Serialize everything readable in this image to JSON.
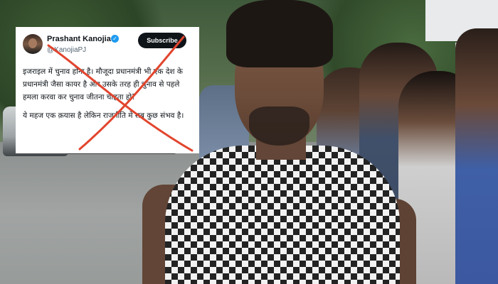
{
  "tweet": {
    "display_name": "Prashant Kanojia",
    "handle": "@KanojiaPJ",
    "subscribe_label": "Subscribe",
    "paragraph_1": "इजराइल में चुनाव होना है। मौजूदा प्रधानमंत्री भी एक देश के प्रधानमंत्री जैसा कायर है और उसके तरह ही चुनाव से पहले हमला करवा कर चुनाव जीतना चाहता हो?",
    "paragraph_2": "ये महज एक क़यास है लेकिन राजनीति में सब कुछ संभव है।"
  },
  "colors": {
    "cross_mark": "#e2452e",
    "verified_badge": "#1d9bf0",
    "subscribe_bg": "#0f1419"
  },
  "icons": {
    "verified": "verified-badge-icon",
    "cross": "cross-out-mark-icon"
  }
}
